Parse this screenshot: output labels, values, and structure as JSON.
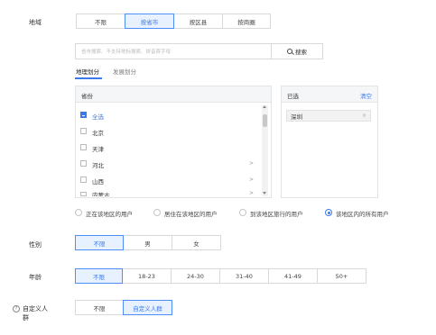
{
  "region": {
    "label": "地域",
    "options": [
      "不限",
      "按省市",
      "按区县",
      "按商圈"
    ],
    "selected_index": 1,
    "search": {
      "placeholder": "省市搜索、不支持地标搜索、拼音首字母",
      "button_label": "搜索",
      "icon": "search-icon"
    },
    "tabs": [
      "地理划分",
      "发展划分"
    ],
    "active_tab_index": 0,
    "province_panel": {
      "header": "省份",
      "items": [
        {
          "label": "全选",
          "checked": true
        },
        {
          "label": "北京",
          "checked": false
        },
        {
          "label": "天津",
          "checked": false
        },
        {
          "label": "河北",
          "checked": false,
          "has_children": true
        },
        {
          "label": "山西",
          "checked": false,
          "has_children": true
        },
        {
          "label": "内蒙古",
          "checked": false,
          "has_children": true
        }
      ]
    },
    "selected_panel": {
      "header": "已选",
      "clear_label": "清空",
      "items": [
        "深圳"
      ]
    },
    "user_scope": {
      "options": [
        "正在该地区的用户",
        "居住在该地区的用户",
        "到该地区旅行的用户",
        "该地区内的所有用户"
      ],
      "selected_index": 3
    }
  },
  "gender": {
    "label": "性别",
    "options": [
      "不限",
      "男",
      "女"
    ],
    "selected_index": 0
  },
  "age": {
    "label": "年龄",
    "options": [
      "不限",
      "18-23",
      "24-30",
      "31-40",
      "41-49",
      "50+"
    ],
    "selected_index": 0
  },
  "custom_audience": {
    "label_line1": "自定义人",
    "label_line2": "群",
    "help_icon": "question-circle-icon",
    "help_glyph": "?",
    "options": [
      "不限",
      "自定义人群"
    ],
    "selected_index": 1
  },
  "colors": {
    "accent": "#3b7ae8",
    "active_bg": "#e8f1ff",
    "border": "#d9d9d9"
  }
}
